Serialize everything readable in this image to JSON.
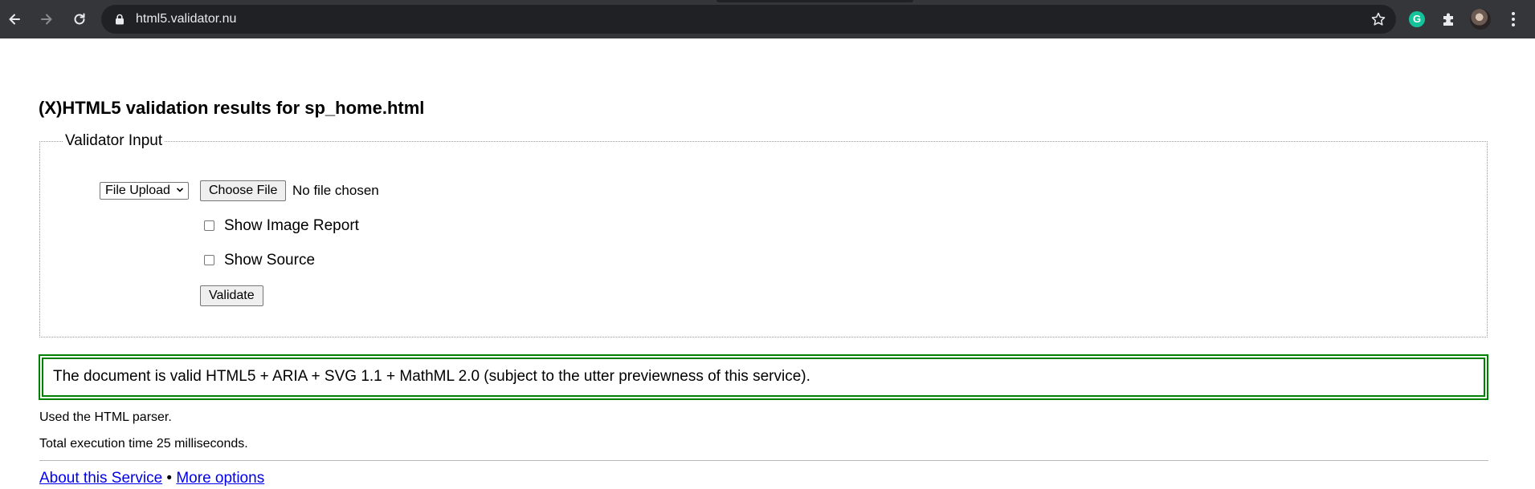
{
  "browser": {
    "url": "html5.validator.nu",
    "icons": {
      "back": "arrow-left-icon",
      "forward": "arrow-right-icon",
      "reload": "reload-icon",
      "lock": "lock-icon",
      "bookmark": "star-icon",
      "grammarly": "grammarly-icon",
      "extensions": "puzzle-icon",
      "profile": "avatar",
      "menu": "kebab-menu-icon"
    },
    "grammarly_letter": "G"
  },
  "page": {
    "title": "(X)HTML5 validation results for sp_home.html",
    "form": {
      "legend": "Validator Input",
      "input_mode": {
        "selected": "File Upload"
      },
      "choose_file_label": "Choose File",
      "file_status": "No file chosen",
      "show_image_report_label": "Show Image Report",
      "show_image_report_checked": false,
      "show_source_label": "Show Source",
      "show_source_checked": false,
      "validate_label": "Validate"
    },
    "result": {
      "message": "The document is valid HTML5 + ARIA + SVG 1.1 + MathML 2.0 (subject to the utter previewness of this service).",
      "border_color": "#008000"
    },
    "notes": {
      "parser": "Used the HTML parser.",
      "execution_time": "Total execution time 25 milliseconds."
    },
    "footer": {
      "about_link": "About this Service",
      "separator": "•",
      "more_options_link": "More options"
    }
  }
}
